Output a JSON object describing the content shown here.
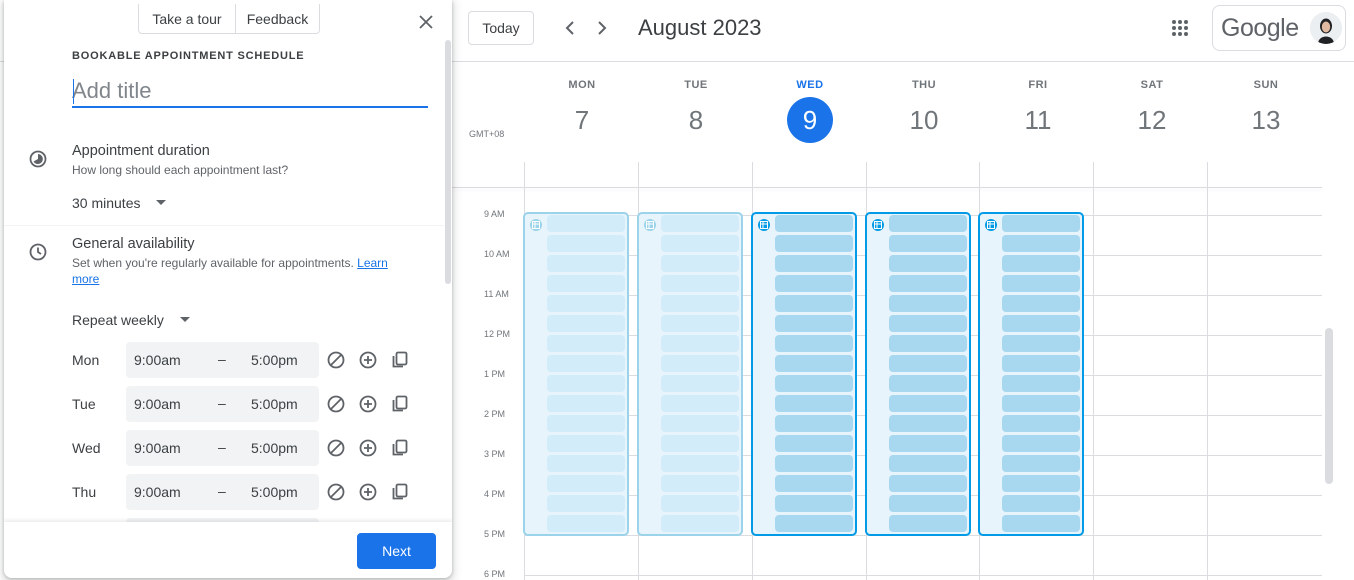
{
  "header": {
    "today_label": "Today",
    "month_label": "August 2023",
    "brand": "Google"
  },
  "timezone": "GMT+08",
  "days": [
    {
      "name": "MON",
      "num": "7"
    },
    {
      "name": "TUE",
      "num": "8"
    },
    {
      "name": "WED",
      "num": "9"
    },
    {
      "name": "THU",
      "num": "10"
    },
    {
      "name": "FRI",
      "num": "11"
    },
    {
      "name": "SAT",
      "num": "12"
    },
    {
      "name": "SUN",
      "num": "13"
    }
  ],
  "today_index": 2,
  "hours": [
    "9 AM",
    "10 AM",
    "11 AM",
    "12 PM",
    "1 PM",
    "2 PM",
    "3 PM",
    "4 PM",
    "5 PM",
    "6 PM"
  ],
  "panel": {
    "tour_label": "Take a tour",
    "feedback_label": "Feedback",
    "heading": "BOOKABLE APPOINTMENT SCHEDULE",
    "title_placeholder": "Add title",
    "duration": {
      "title": "Appointment duration",
      "subtitle": "How long should each appointment last?",
      "value": "30 minutes"
    },
    "availability": {
      "title": "General availability",
      "subtitle": "Set when you're regularly available for appointments.",
      "link": "Learn more",
      "repeat": "Repeat weekly"
    },
    "rows": [
      {
        "day": "Mon",
        "start": "9:00am",
        "dash": "–",
        "end": "5:00pm"
      },
      {
        "day": "Tue",
        "start": "9:00am",
        "dash": "–",
        "end": "5:00pm"
      },
      {
        "day": "Wed",
        "start": "9:00am",
        "dash": "–",
        "end": "5:00pm"
      },
      {
        "day": "Thu",
        "start": "9:00am",
        "dash": "–",
        "end": "5:00pm"
      }
    ],
    "next_label": "Next"
  },
  "colors": {
    "accent": "#1a73e8",
    "slot_future": "#a8d8f0",
    "slot_past": "#d2ecf9",
    "block_border_future": "#039be5",
    "block_border_past": "#9bd3ea"
  }
}
